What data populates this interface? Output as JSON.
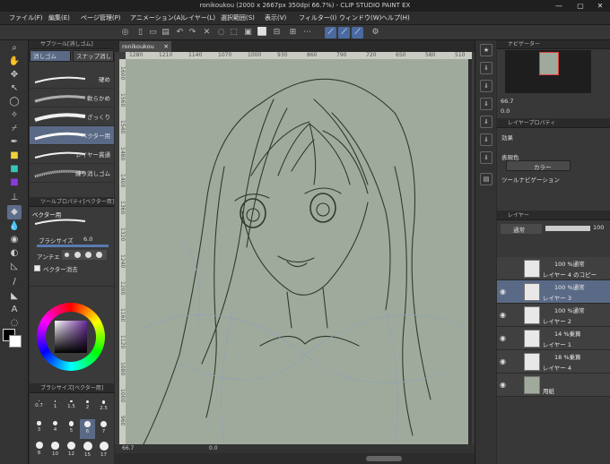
{
  "window": {
    "title": "ronikoukou (2000 x 2667px 350dpi 66.7%) - CLIP STUDIO PAINT EX",
    "minimize": "—",
    "maximize": "▢",
    "close": "✕"
  },
  "menu": [
    "ファイル(F)",
    "編集(E)",
    "ページ管理(P)",
    "アニメーション(A)",
    "レイヤー(L)",
    "選択範囲(S)",
    "表示(V)",
    "フィルター(I)",
    "ウィンドウ(W)",
    "ヘルプ(H)"
  ],
  "subtool_panel": {
    "header": "サブツール[消しゴム]",
    "tabs": [
      "消しゴム",
      "スナップ消し"
    ],
    "brushes": [
      "硬め",
      "軟らかめ",
      "ざっくり",
      "ベクター用",
      "レイヤー貫通",
      "練り消しゴム"
    ],
    "selected_index": 3
  },
  "tool_property": {
    "header": "ツールプロパティ[ベクター用]",
    "tool_name": "ベクター用",
    "brush_size_label": "ブラシサイズ",
    "brush_size_value": "6.0",
    "antialias_label": "アンチエ",
    "vector_erase_label": "ベクター消去"
  },
  "brush_size_panel": {
    "header": "ブラシサイズ[ベクター用]",
    "sizes": [
      "0.7",
      "1",
      "1.5",
      "2",
      "2.5",
      "3",
      "4",
      "5",
      "6",
      "7",
      "8",
      "10",
      "12",
      "15",
      "17"
    ],
    "selected_index": 8
  },
  "colors": {
    "main": "#000000",
    "sub": "#ffffff",
    "canvas": "#a0aa9c"
  },
  "canvas": {
    "tab_label": "ronikoukou",
    "ruler_h": [
      "1280",
      "1210",
      "1140",
      "1070",
      "1000",
      "930",
      "860",
      "790",
      "720",
      "650",
      "580",
      "510"
    ],
    "ruler_v": [
      "1600",
      "1560",
      "1540",
      "1480",
      "1400",
      "1360",
      "1320",
      "1240",
      "1200",
      "1160",
      "1120",
      "1080",
      "1000",
      "960"
    ],
    "zoom": "66.7",
    "rotation": "0.0"
  },
  "navigator": {
    "header": "ナビゲーター",
    "zoom": "66.7",
    "rotation": "0.0"
  },
  "layer_property": {
    "header": "レイヤープロパティ",
    "effect_label": "効果",
    "expression_label": "表現色",
    "expression_value": "カラー",
    "ruler_nav_label": "ツールナビゲーション"
  },
  "layer_panel": {
    "header": "レイヤー",
    "blend_mode": "通常",
    "opacity": "100",
    "layers": [
      {
        "mode": "100 %通常",
        "name": "レイヤー 4 のコピー",
        "visible": false
      },
      {
        "mode": "100 %通常",
        "name": "レイヤー 3",
        "visible": true
      },
      {
        "mode": "100 %通常",
        "name": "レイヤー 2",
        "visible": true
      },
      {
        "mode": "14 %乗算",
        "name": "レイヤー 1",
        "visible": true
      },
      {
        "mode": "18 %乗算",
        "name": "レイヤー 4",
        "visible": true
      },
      {
        "mode": "",
        "name": "用紙",
        "visible": true
      }
    ],
    "selected_index": 1
  }
}
